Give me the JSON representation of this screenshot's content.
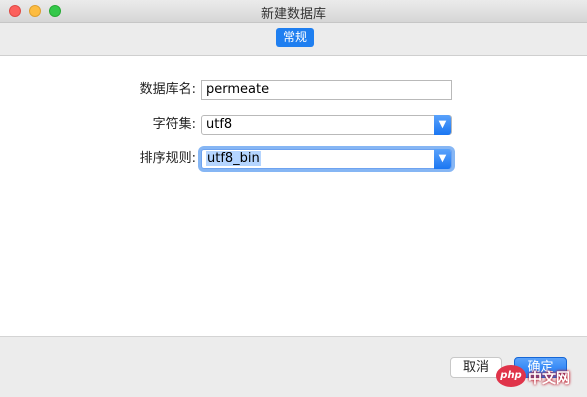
{
  "window": {
    "title": "新建数据库"
  },
  "toolbar": {
    "tab_general": "常规"
  },
  "form": {
    "db_name_label": "数据库名:",
    "db_name_value": "permeate",
    "charset_label": "字符集:",
    "charset_value": "utf8",
    "collation_label": "排序规则:",
    "collation_value": "utf8_bin"
  },
  "footer": {
    "cancel_label": "取消",
    "ok_label": "确定"
  },
  "watermark": {
    "brand": "php",
    "text": "中文网"
  },
  "colors": {
    "accent": "#1f7ff0",
    "selection": "#b5d5ff"
  }
}
